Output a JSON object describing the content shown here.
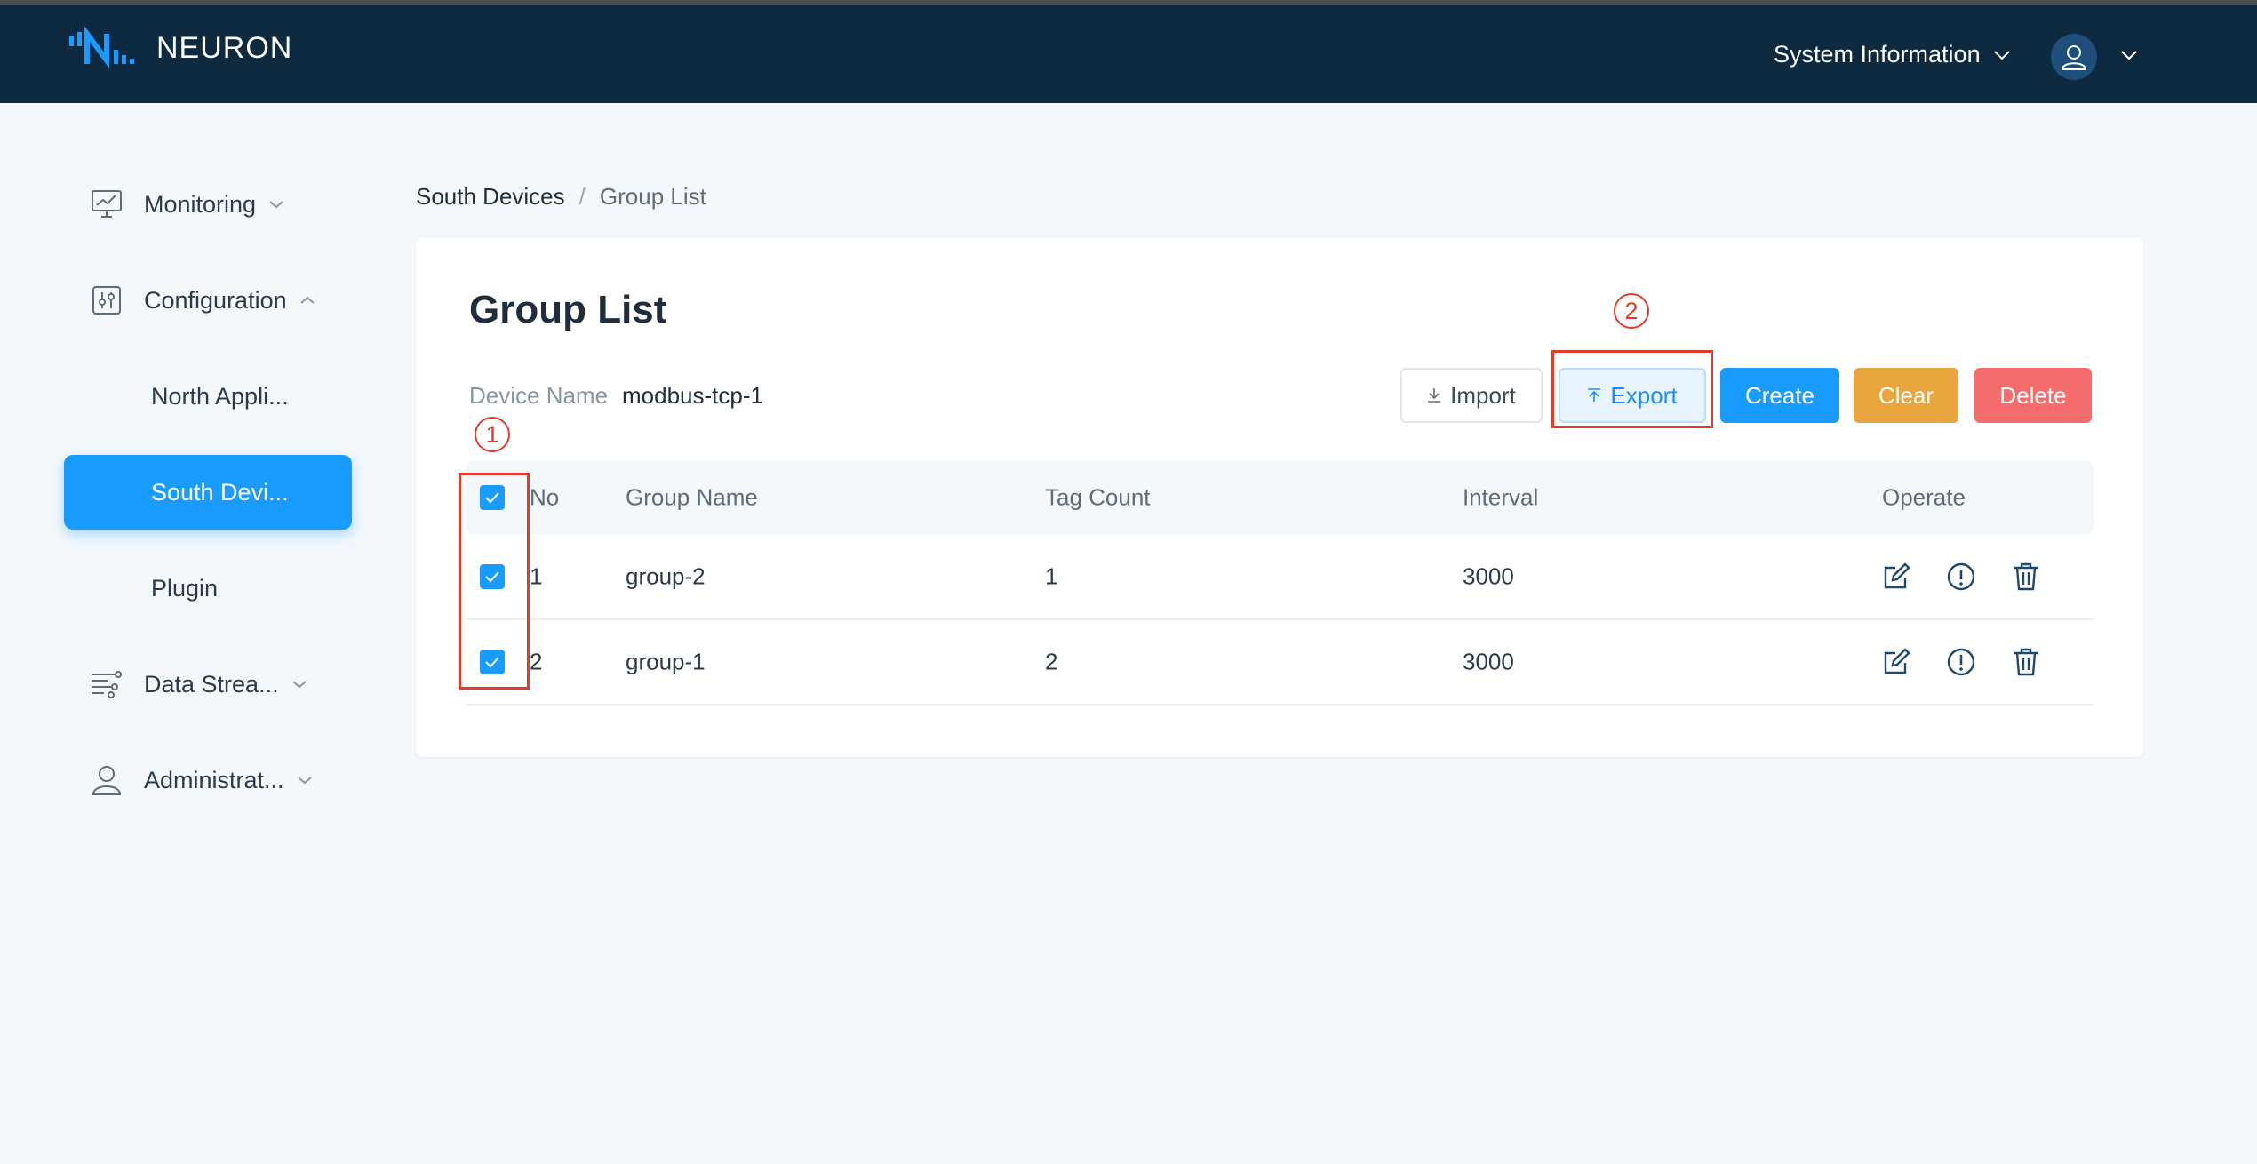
{
  "header": {
    "logo_text": "NEURON",
    "system_info_label": "System Information"
  },
  "sidebar": {
    "items": [
      {
        "label": "Monitoring",
        "icon": "monitor-chart-icon",
        "expanded": false
      },
      {
        "label": "Configuration",
        "icon": "sliders-icon",
        "expanded": true
      },
      {
        "label": "North Appli...",
        "sub": true
      },
      {
        "label": "South Devi...",
        "sub": true,
        "active": true
      },
      {
        "label": "Plugin",
        "sub": true
      },
      {
        "label": "Data Strea...",
        "icon": "data-stream-icon",
        "expanded": false
      },
      {
        "label": "Administrat...",
        "icon": "user-icon",
        "expanded": false
      }
    ]
  },
  "breadcrumb": {
    "parent": "South Devices",
    "separator": "/",
    "current": "Group List"
  },
  "page": {
    "title": "Group List",
    "device_name_label": "Device Name",
    "device_name_value": "modbus-tcp-1"
  },
  "toolbar": {
    "import_label": "Import",
    "export_label": "Export",
    "create_label": "Create",
    "clear_label": "Clear",
    "delete_label": "Delete"
  },
  "table": {
    "columns": [
      "No",
      "Group Name",
      "Tag Count",
      "Interval",
      "Operate"
    ],
    "rows": [
      {
        "no": "1",
        "group_name": "group-2",
        "tag_count": "1",
        "interval": "3000",
        "checked": true
      },
      {
        "no": "2",
        "group_name": "group-1",
        "tag_count": "2",
        "interval": "3000",
        "checked": true
      }
    ]
  },
  "annotations": {
    "step1": "1",
    "step2": "2"
  },
  "colors": {
    "header_bg": "#0e2a40",
    "primary": "#1a9bff",
    "warning": "#e9a53e",
    "danger": "#f56c6c",
    "annotation": "#e43a2a"
  }
}
